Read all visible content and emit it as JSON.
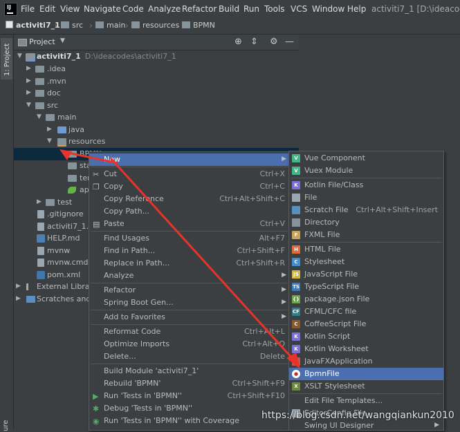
{
  "menubar": {
    "items": [
      "File",
      "Edit",
      "View",
      "Navigate",
      "Code",
      "Analyze",
      "Refactor",
      "Build",
      "Run",
      "Tools",
      "VCS",
      "Window",
      "Help"
    ],
    "window_title": "activiti7_1 [D:\\ideacodes"
  },
  "breadcrumb": [
    "activiti7_1",
    "src",
    "main",
    "resources",
    "BPMN"
  ],
  "stripe": {
    "project_tab": "1: Project",
    "bottom_tab": "ure"
  },
  "panel": {
    "title": "Project"
  },
  "tree": [
    {
      "label": "activiti7_1",
      "path": "D:\\ideacodes\\activiti7_1"
    },
    {
      "label": ".idea"
    },
    {
      "label": ".mvn"
    },
    {
      "label": "doc"
    },
    {
      "label": "src"
    },
    {
      "label": "main"
    },
    {
      "label": "java"
    },
    {
      "label": "resources"
    },
    {
      "label": "BPMN"
    },
    {
      "label": "sta"
    },
    {
      "label": "ter"
    },
    {
      "label": "ap"
    },
    {
      "label": "test"
    },
    {
      "label": ".gitignore"
    },
    {
      "label": "activiti7_1.im"
    },
    {
      "label": "HELP.md"
    },
    {
      "label": "mvnw"
    },
    {
      "label": "mvnw.cmd"
    },
    {
      "label": "pom.xml"
    },
    {
      "label": "External Librari"
    },
    {
      "label": "Scratches and C"
    }
  ],
  "context_menu": [
    {
      "label": "New",
      "shortcut": "",
      "sub": true
    },
    {
      "label": "Cut",
      "shortcut": "Ctrl+X"
    },
    {
      "label": "Copy",
      "shortcut": "Ctrl+C"
    },
    {
      "label": "Copy Reference",
      "shortcut": "Ctrl+Alt+Shift+C"
    },
    {
      "label": "Copy Path...",
      "shortcut": ""
    },
    {
      "label": "Paste",
      "shortcut": "Ctrl+V"
    },
    {
      "label": "Find Usages",
      "shortcut": "Alt+F7"
    },
    {
      "label": "Find in Path...",
      "shortcut": "Ctrl+Shift+F"
    },
    {
      "label": "Replace in Path...",
      "shortcut": "Ctrl+Shift+R"
    },
    {
      "label": "Analyze",
      "shortcut": "",
      "sub": true
    },
    {
      "label": "Refactor",
      "shortcut": "",
      "sub": true
    },
    {
      "label": "Spring Boot Gen...",
      "shortcut": "",
      "sub": true
    },
    {
      "label": "Add to Favorites",
      "shortcut": "",
      "sub": true
    },
    {
      "label": "Reformat Code",
      "shortcut": "Ctrl+Alt+L"
    },
    {
      "label": "Optimize Imports",
      "shortcut": "Ctrl+Alt+O"
    },
    {
      "label": "Delete...",
      "shortcut": "Delete"
    },
    {
      "label": "Build Module 'activiti7_1'",
      "shortcut": ""
    },
    {
      "label": "Rebuild 'BPMN'",
      "shortcut": "Ctrl+Shift+F9"
    },
    {
      "label": "Run 'Tests in 'BPMN''",
      "shortcut": "Ctrl+Shift+F10"
    },
    {
      "label": "Debug 'Tests in 'BPMN''",
      "shortcut": ""
    },
    {
      "label": "Run 'Tests in 'BPMN'' with Coverage",
      "shortcut": ""
    }
  ],
  "new_submenu": [
    {
      "label": "Vue Component",
      "shortcut": ""
    },
    {
      "label": "Vuex Module",
      "shortcut": ""
    },
    {
      "label": "Kotlin File/Class",
      "shortcut": ""
    },
    {
      "label": "File",
      "shortcut": ""
    },
    {
      "label": "Scratch File",
      "shortcut": "Ctrl+Alt+Shift+Insert"
    },
    {
      "label": "Directory",
      "shortcut": ""
    },
    {
      "label": "FXML File",
      "shortcut": ""
    },
    {
      "label": "HTML File",
      "shortcut": ""
    },
    {
      "label": "Stylesheet",
      "shortcut": ""
    },
    {
      "label": "JavaScript File",
      "shortcut": ""
    },
    {
      "label": "TypeScript File",
      "shortcut": ""
    },
    {
      "label": "package.json File",
      "shortcut": ""
    },
    {
      "label": "CFML/CFC file",
      "shortcut": ""
    },
    {
      "label": "CoffeeScript File",
      "shortcut": ""
    },
    {
      "label": "Kotlin Script",
      "shortcut": ""
    },
    {
      "label": "Kotlin Worksheet",
      "shortcut": ""
    },
    {
      "label": "JavaFXApplication",
      "shortcut": ""
    },
    {
      "label": "BpmnFile",
      "shortcut": ""
    },
    {
      "label": "XSLT Stylesheet",
      "shortcut": ""
    },
    {
      "label": "Edit File Templates...",
      "shortcut": ""
    },
    {
      "label": "EditorConfig File",
      "shortcut": ""
    },
    {
      "label": "Swing UI Designer",
      "shortcut": ""
    }
  ],
  "watermark": "https://blog.csdn.net/wangqiankun2010",
  "colors": {
    "selection": "#4b6eaf",
    "arrow": "#e8332a",
    "background": "#3c3f41"
  }
}
